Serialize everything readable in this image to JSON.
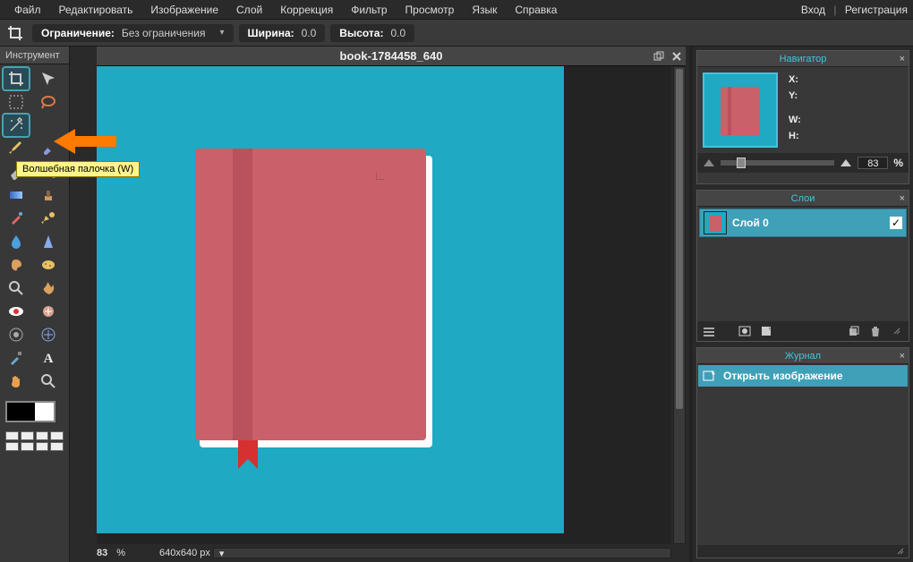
{
  "menu": [
    "Файл",
    "Редактировать",
    "Изображение",
    "Слой",
    "Коррекция",
    "Фильтр",
    "Просмотр",
    "Язык",
    "Справка"
  ],
  "auth": {
    "login": "Вход",
    "register": "Регистрация"
  },
  "options": {
    "constraint_label": "Ограничение:",
    "constraint_value": "Без ограничения",
    "width_label": "Ширина:",
    "width_value": "0.0",
    "height_label": "Высота:",
    "height_value": "0.0"
  },
  "tools": {
    "title": "Инструмент",
    "tooltip": "Волшебная палочка (W)",
    "items": [
      {
        "name": "crop-icon",
        "selected": true
      },
      {
        "name": "move-icon"
      },
      {
        "name": "marquee-icon"
      },
      {
        "name": "lasso-icon"
      },
      {
        "name": "wand-icon",
        "highlight": true
      },
      {
        "name": "empty"
      },
      {
        "name": "pencil-icon"
      },
      {
        "name": "brush-icon"
      },
      {
        "name": "eraser-icon"
      },
      {
        "name": "bucket-icon"
      },
      {
        "name": "gradient-icon"
      },
      {
        "name": "clone-icon"
      },
      {
        "name": "replace-color-icon"
      },
      {
        "name": "draw-icon"
      },
      {
        "name": "blur-icon"
      },
      {
        "name": "sharpen-icon"
      },
      {
        "name": "smudge-icon"
      },
      {
        "name": "sponge-icon"
      },
      {
        "name": "dodge-icon"
      },
      {
        "name": "burn-icon"
      },
      {
        "name": "redeye-icon"
      },
      {
        "name": "spot-icon"
      },
      {
        "name": "bloat-icon"
      },
      {
        "name": "pinch-icon"
      },
      {
        "name": "picker-icon"
      },
      {
        "name": "type-icon"
      },
      {
        "name": "hand-icon"
      },
      {
        "name": "zoom-icon"
      }
    ]
  },
  "document": {
    "title": "book-1784458_640",
    "zoom_pct": "83",
    "pct_sym": "%",
    "dims": "640x640 px"
  },
  "navigator": {
    "title": "Навигатор",
    "x_label": "X:",
    "y_label": "Y:",
    "w_label": "W:",
    "h_label": "H:",
    "zoom": "83",
    "pct": "%"
  },
  "layers": {
    "title": "Слои",
    "items": [
      {
        "name": "Слой 0",
        "visible": true
      }
    ]
  },
  "history": {
    "title": "Журнал",
    "items": [
      "Открыть изображение"
    ]
  }
}
